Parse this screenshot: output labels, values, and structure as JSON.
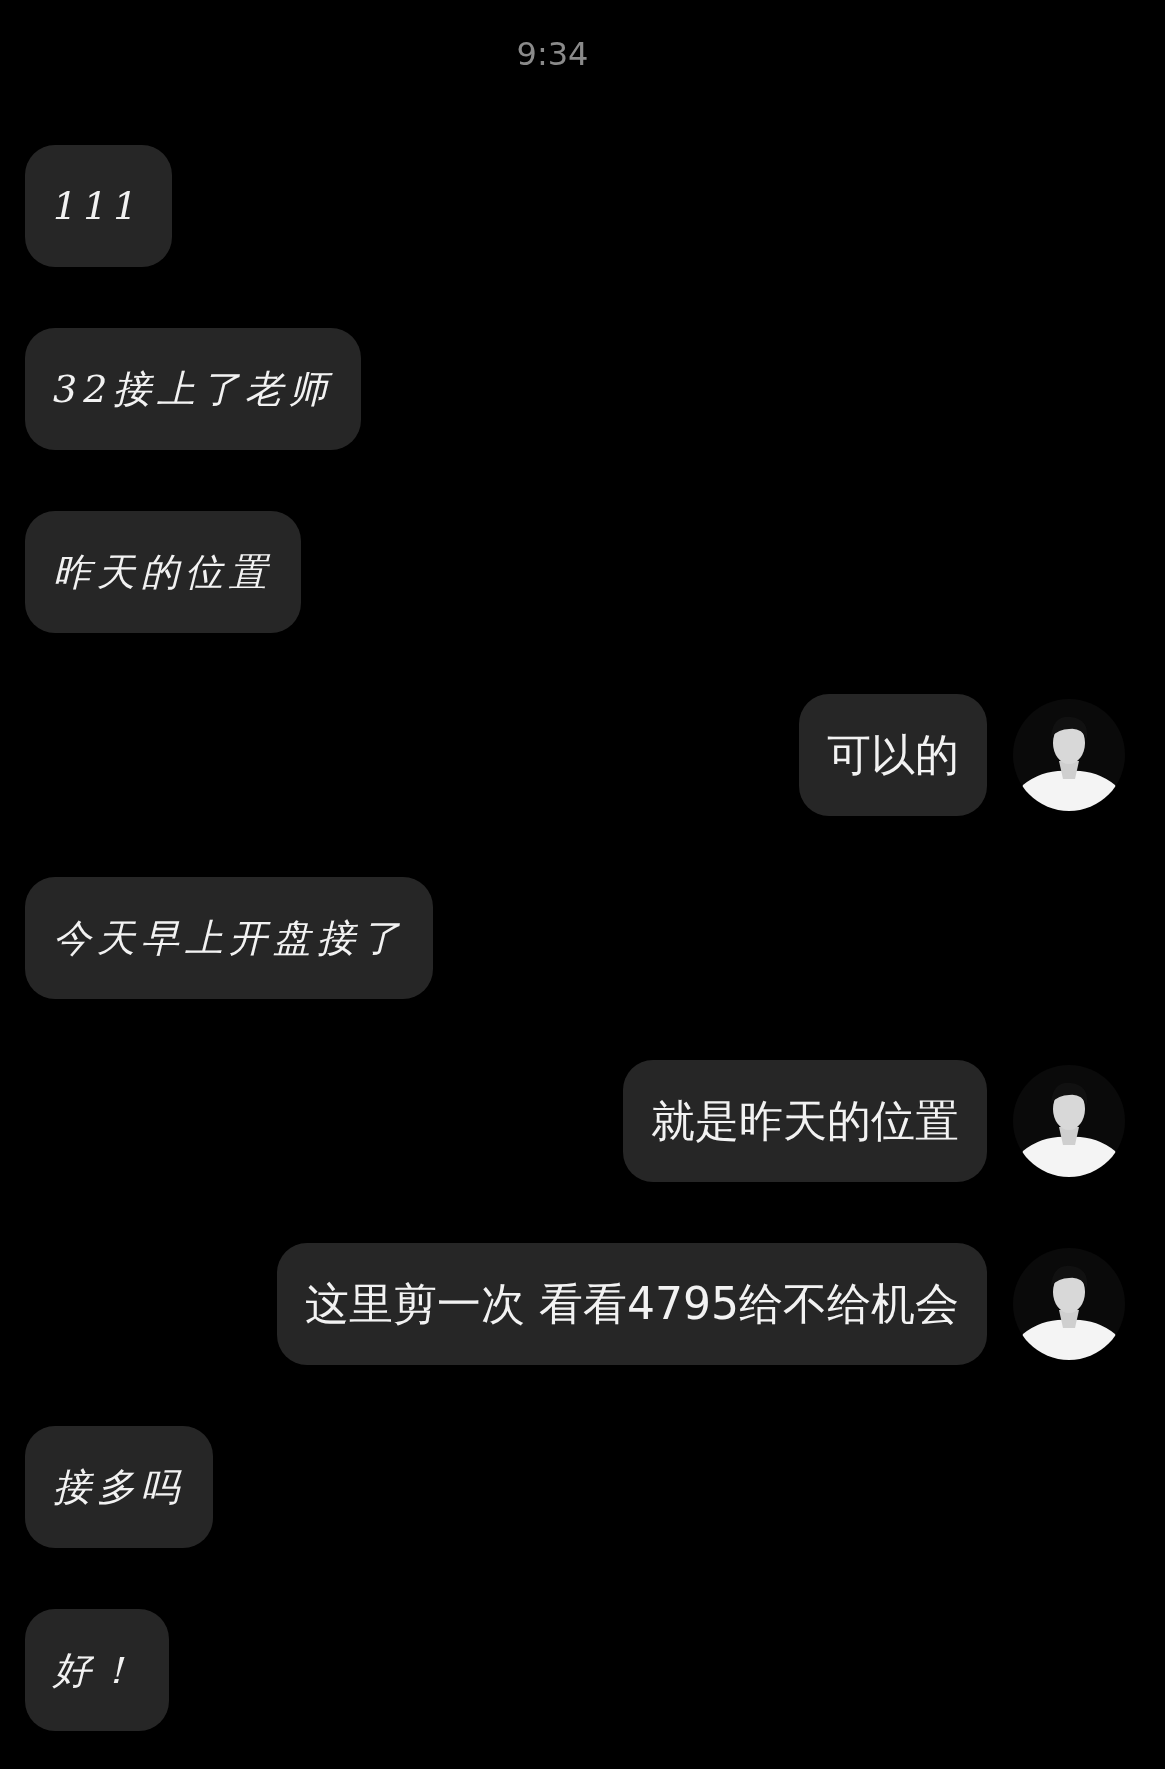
{
  "status_time": "9:34",
  "messages": [
    {
      "kind": "received",
      "text": "111"
    },
    {
      "kind": "received",
      "text": "32接上了老师"
    },
    {
      "kind": "received",
      "text": "昨天的位置"
    },
    {
      "kind": "sent",
      "text": "可以的"
    },
    {
      "kind": "received",
      "text": "今天早上开盘接了"
    },
    {
      "kind": "sent",
      "text": "就是昨天的位置"
    },
    {
      "kind": "sent",
      "text": "这里剪一次 看看4795给不给机会"
    },
    {
      "kind": "received",
      "text": "接多吗"
    },
    {
      "kind": "received",
      "text": "好！"
    }
  ]
}
